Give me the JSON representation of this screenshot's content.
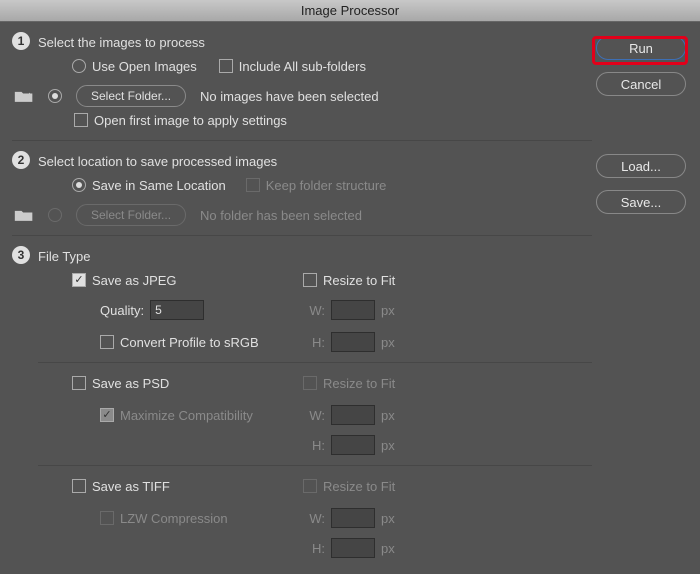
{
  "title": "Image Processor",
  "buttons": {
    "run": "Run",
    "cancel": "Cancel",
    "load": "Load...",
    "save": "Save..."
  },
  "steps": {
    "s1": {
      "num": "1",
      "heading": "Select the images to process",
      "use_open": "Use Open Images",
      "include_sub": "Include All sub-folders",
      "select_folder": "Select Folder...",
      "no_images": "No images have been selected",
      "open_first": "Open first image to apply settings"
    },
    "s2": {
      "num": "2",
      "heading": "Select location to save processed images",
      "same_loc": "Save in Same Location",
      "keep_struct": "Keep folder structure",
      "select_folder": "Select Folder...",
      "no_folder": "No folder has been selected"
    },
    "s3": {
      "num": "3",
      "heading": "File Type",
      "save_jpeg": "Save as JPEG",
      "quality": "Quality:",
      "quality_val": "5",
      "convert_srgb": "Convert Profile to sRGB",
      "save_psd": "Save as PSD",
      "max_compat": "Maximize Compatibility",
      "save_tiff": "Save as TIFF",
      "lzw": "LZW Compression",
      "resize": "Resize to Fit",
      "w": "W:",
      "h": "H:",
      "px": "px"
    }
  }
}
